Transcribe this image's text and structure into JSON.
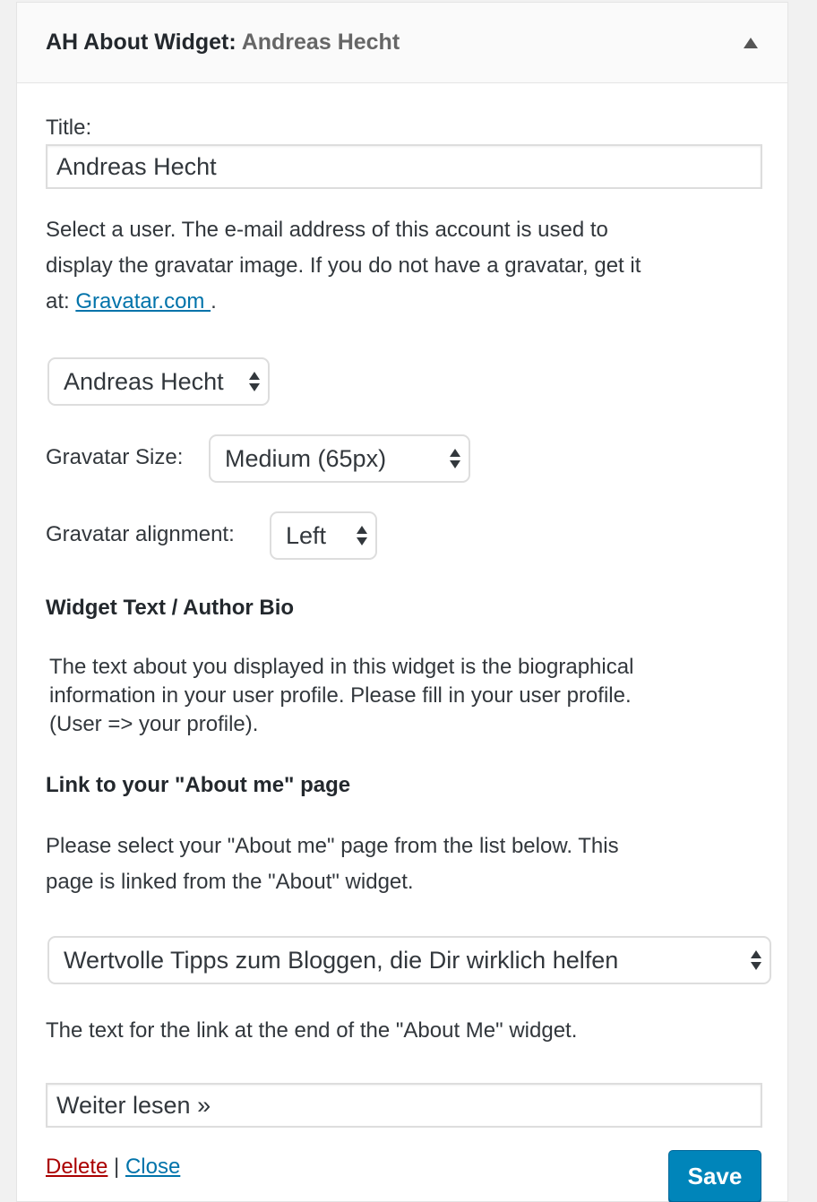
{
  "widget": {
    "title_prefix": "AH About Widget",
    "title_colon": ":",
    "title_suffix": " Andreas Hecht",
    "toggle_icon": "triangle-up-icon"
  },
  "title_field": {
    "label": "Title:",
    "value": "Andreas Hecht"
  },
  "user_help": {
    "text_line1": "Select a user. The e-mail address of this account is used to",
    "text_line2": "display the gravatar image. If you do not have a gravatar, get it",
    "text_line3_prefix": "at: ",
    "link_text": "Gravatar.com ",
    "text_line3_suffix": "."
  },
  "user_select": {
    "selected": "Andreas Hecht"
  },
  "gravatar_size": {
    "label": "Gravatar Size:",
    "selected": "Medium (65px)"
  },
  "gravatar_alignment": {
    "label": "Gravatar alignment:",
    "selected": "Left"
  },
  "widget_text": {
    "heading": "Widget Text / Author Bio",
    "line1": "The text about you displayed in this widget is the biographical",
    "line2": "information in your user profile. Please fill in your user profile.",
    "line3": "(User => your profile)."
  },
  "about_link": {
    "heading": "Link to your \"About me\" page",
    "line1": "Please select your \"About me\" page from the list below. This",
    "line2": "page is linked from the \"About\" widget.",
    "selected_page": "Wertvolle Tipps zum Bloggen, die Dir wirklich helfen"
  },
  "link_text_field": {
    "label": "The text for the link at the end of the \"About Me\" widget.",
    "value": "Weiter lesen »"
  },
  "actions": {
    "delete": "Delete",
    "separator": "|",
    "close": "Close",
    "save": "Save"
  },
  "colors": {
    "link": "#0073aa",
    "delete": "#aa0000",
    "save_button": "#0085ba"
  }
}
